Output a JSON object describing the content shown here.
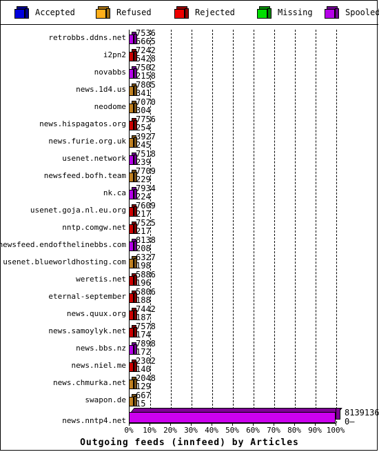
{
  "legend": {
    "items": [
      {
        "label": "Accepted",
        "color": "#0000dd",
        "icon": "cube-icon"
      },
      {
        "label": "Refused",
        "color": "#ffae1a",
        "icon": "cube-icon"
      },
      {
        "label": "Rejected",
        "color": "#ee0000",
        "icon": "cube-icon"
      },
      {
        "label": "Missing",
        "color": "#00dd00",
        "icon": "cube-icon"
      },
      {
        "label": "Spooled",
        "color": "#b500e8",
        "icon": "cube-icon"
      }
    ]
  },
  "chart_data": {
    "type": "bar",
    "title": "",
    "xlabel": "Outgoing feeds (innfeed) by Articles",
    "ylabel": "",
    "orientation": "horizontal",
    "grid": true,
    "legend_position": "top",
    "xlim": [
      0,
      100
    ],
    "xunit": "%",
    "xticks": [
      "0%",
      "10%",
      "20%",
      "30%",
      "40%",
      "50%",
      "60%",
      "70%",
      "80%",
      "90%",
      "100%"
    ],
    "categories": [
      "retrobbs.ddns.net",
      "i2pn2",
      "novabbs",
      "news.1d4.us",
      "neodome",
      "news.hispagatos.org",
      "news.furie.org.uk",
      "usenet.network",
      "newsfeed.bofh.team",
      "nk.ca",
      "usenet.goja.nl.eu.org",
      "nntp.comgw.net",
      "newsfeed.endofthelinebbs.com",
      "usenet.blueworldhosting.com",
      "weretis.net",
      "eternal-september",
      "news.quux.org",
      "news.samoylyk.net",
      "news.bbs.nz",
      "news.niel.me",
      "news.chmurka.net",
      "swapon.de",
      "news.nntp4.net"
    ],
    "series": [
      {
        "name": "value_upper",
        "values": [
          7536,
          7242,
          7502,
          7805,
          7070,
          7756,
          3927,
          7518,
          7709,
          7934,
          7609,
          7525,
          8138,
          6327,
          5886,
          5806,
          7442,
          7578,
          7898,
          2302,
          2048,
          667,
          8139136
        ]
      },
      {
        "name": "value_lower",
        "values": [
          6665,
          5428,
          2158,
          341,
          304,
          254,
          245,
          239,
          229,
          224,
          217,
          217,
          208,
          198,
          196,
          188,
          187,
          174,
          172,
          140,
          129,
          15,
          0
        ]
      }
    ],
    "bar_colors": [
      "#b500e8",
      "#cc0000",
      "#b500e8",
      "#c08020",
      "#c08020",
      "#cc0000",
      "#c08020",
      "#b500e8",
      "#c08020",
      "#b500e8",
      "#cc0000",
      "#cc0000",
      "#b500e8",
      "#c08020",
      "#cc0000",
      "#cc0000",
      "#cc0000",
      "#cc0000",
      "#b500e8",
      "#cc0000",
      "#c08020",
      "#c08020",
      "#cc00ee"
    ],
    "bar_widths_pct": [
      0.1,
      0.09,
      0.09,
      0.1,
      0.09,
      0.1,
      0.05,
      0.09,
      0.09,
      0.1,
      0.09,
      0.09,
      0.1,
      0.08,
      0.07,
      0.07,
      0.09,
      0.09,
      0.1,
      0.03,
      0.03,
      0.01,
      100
    ]
  }
}
